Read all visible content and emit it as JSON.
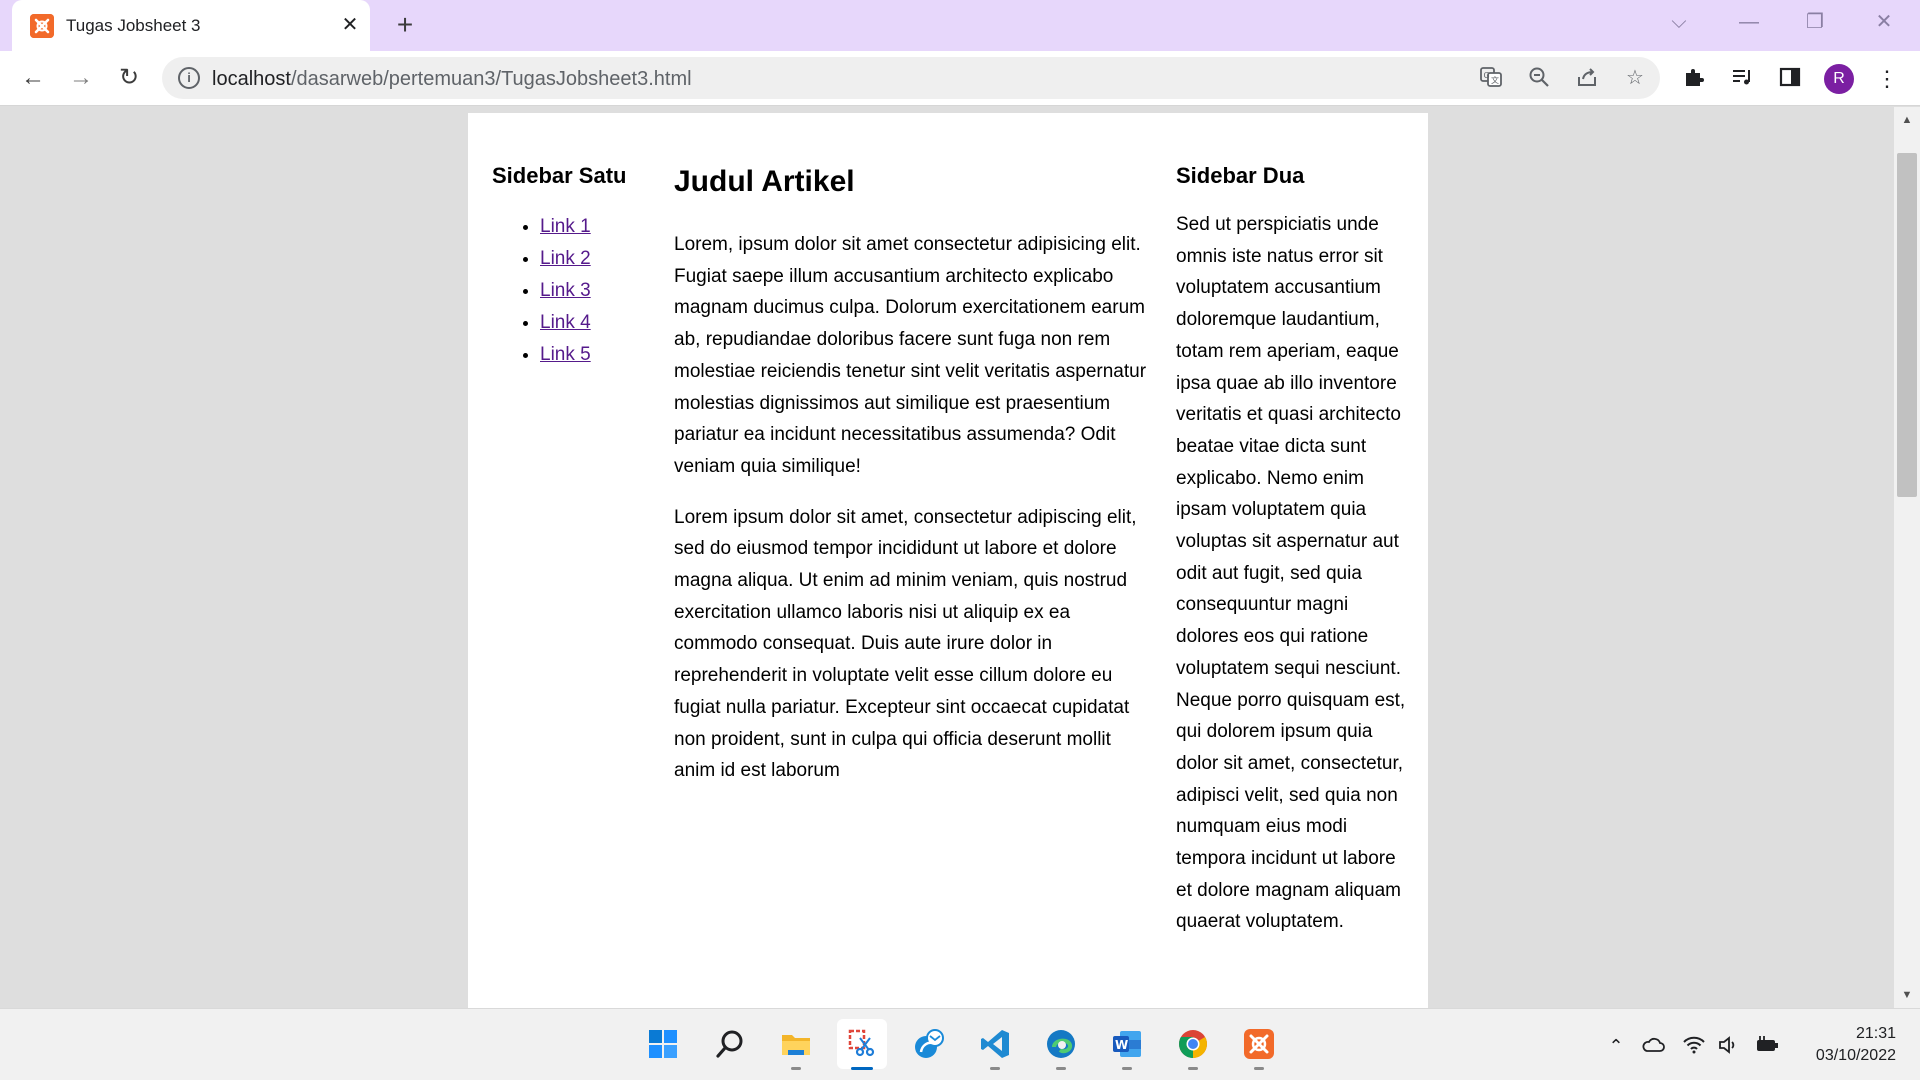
{
  "browser": {
    "tab": {
      "title": "Tugas Jobsheet 3",
      "favicon": "xampp-icon"
    },
    "toolbar": {
      "url_host": "localhost",
      "url_path": "/dasarweb/pertemuan3/TugasJobsheet3.html",
      "profile_initial": "R"
    },
    "accent": "#e7d7fb"
  },
  "page": {
    "sidebar1": {
      "heading": "Sidebar Satu",
      "links": [
        "Link 1",
        "Link 2",
        "Link 3",
        "Link 4",
        "Link 5"
      ]
    },
    "article": {
      "title": "Judul Artikel",
      "paragraphs": [
        "Lorem, ipsum dolor sit amet consectetur adipisicing elit. Fugiat saepe illum accusantium architecto explicabo magnam ducimus culpa. Dolorum exercitationem earum ab, repudiandae doloribus facere sunt fuga non rem molestiae reiciendis tenetur sint velit veritatis aspernatur molestias dignissimos aut similique est praesentium pariatur ea incidunt necessitatibus assumenda? Odit veniam quia similique!",
        "Lorem ipsum dolor sit amet, consectetur adipiscing elit, sed do eiusmod tempor incididunt ut labore et dolore magna aliqua. Ut enim ad minim veniam, quis nostrud exercitation ullamco laboris nisi ut aliquip ex ea commodo consequat. Duis aute irure dolor in reprehenderit in voluptate velit esse cillum dolore eu fugiat nulla pariatur. Excepteur sint occaecat cupidatat non proident, sunt in culpa qui officia deserunt mollit anim id est laborum"
      ]
    },
    "sidebar2": {
      "heading": "Sidebar Dua",
      "text": "Sed ut perspiciatis unde omnis iste natus error sit voluptatem accusantium doloremque laudantium, totam rem aperiam, eaque ipsa quae ab illo inventore veritatis et quasi architecto beatae vitae dicta sunt explicabo. Nemo enim ipsam voluptatem quia voluptas sit aspernatur aut odit aut fugit, sed quia consequuntur magni dolores eos qui ratione voluptatem sequi nesciunt. Neque porro quisquam est, qui dolorem ipsum quia dolor sit amet, consectetur, adipisci velit, sed quia non numquam eius modi tempora incidunt ut labore et dolore magnam aliquam quaerat voluptatem."
    }
  },
  "taskbar": {
    "apps": [
      "windows-start-icon",
      "search-icon",
      "file-explorer-icon",
      "snipping-tool-icon",
      "mail-app-icon",
      "vscode-icon",
      "edge-icon",
      "word-icon",
      "chrome-icon",
      "xampp-icon"
    ],
    "clock": {
      "time": "21:31",
      "date": "03/10/2022"
    }
  }
}
